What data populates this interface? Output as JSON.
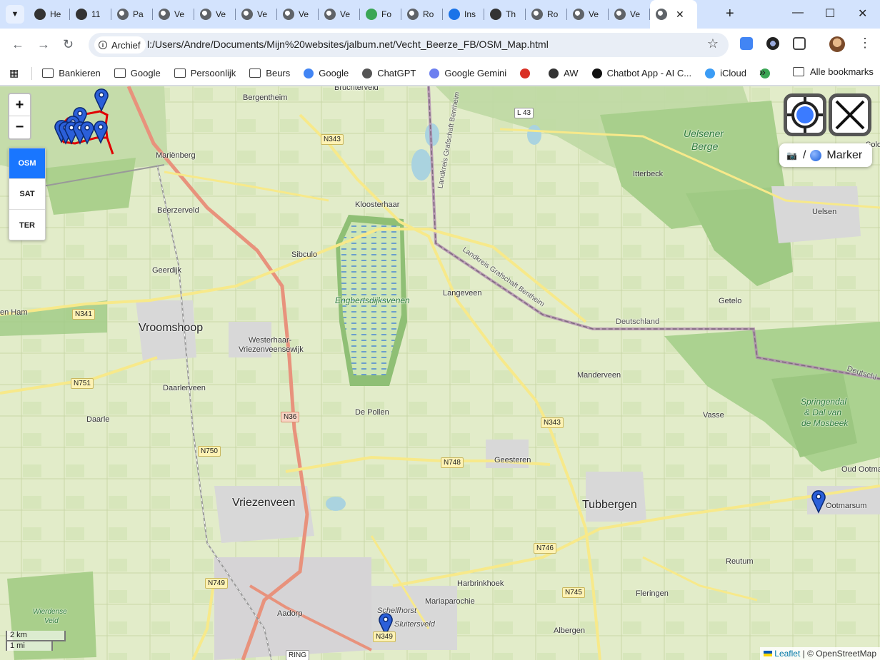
{
  "browser": {
    "tabs": [
      {
        "label": "He",
        "icon": "leaf-icon"
      },
      {
        "label": "11",
        "icon": "leaf-icon"
      },
      {
        "label": "Pa",
        "icon": "globe-icon"
      },
      {
        "label": "Ve",
        "icon": "globe-icon"
      },
      {
        "label": "Ve",
        "icon": "globe-icon"
      },
      {
        "label": "Ve",
        "icon": "globe-icon"
      },
      {
        "label": "Ve",
        "icon": "globe-icon"
      },
      {
        "label": "Ve",
        "icon": "globe-icon"
      },
      {
        "label": "Fo",
        "icon": "frog-icon"
      },
      {
        "label": "Ro",
        "icon": "globe-icon"
      },
      {
        "label": "Ins",
        "icon": "gear-icon"
      },
      {
        "label": "Th",
        "icon": "figure-icon"
      },
      {
        "label": "Ro",
        "icon": "globe-icon"
      },
      {
        "label": "Ve",
        "icon": "globe-icon"
      },
      {
        "label": "Ve",
        "icon": "globe-icon"
      }
    ],
    "active_tab_icon": "globe-icon",
    "close_label": "✕",
    "new_tab_label": "+",
    "minimize_label": "—",
    "maximize_label": "☐",
    "close_window_label": "✕",
    "address": {
      "chip_label": "Archief",
      "url": "l:/Users/Andre/Documents/Mijn%20websites/jalbum.net/Vecht_Beerze_FB/OSM_Map.html"
    },
    "bookmarks": [
      {
        "label": "Bankieren",
        "icon": "folder-icon"
      },
      {
        "label": "Google",
        "icon": "folder-icon"
      },
      {
        "label": "Persoonlijk",
        "icon": "folder-icon"
      },
      {
        "label": "Beurs",
        "icon": "folder-icon"
      },
      {
        "label": "Google",
        "icon": "google-icon"
      },
      {
        "label": "ChatGPT",
        "icon": "chatgpt-icon"
      },
      {
        "label": "Google Gemini",
        "icon": "gemini-icon"
      },
      {
        "label": "",
        "icon": "gmail-icon"
      },
      {
        "label": "AW",
        "icon": "leaf-icon"
      },
      {
        "label": "Chatbot App - AI C...",
        "icon": "chatbot-icon"
      },
      {
        "label": "iCloud",
        "icon": "cloud-icon"
      },
      {
        "label": "",
        "icon": "frog-icon"
      }
    ],
    "bookmarks_more": "»",
    "all_bookmarks": "Alle bookmarks"
  },
  "map": {
    "zoom_in": "+",
    "zoom_out": "−",
    "layers": [
      "OSM",
      "SAT",
      "TER"
    ],
    "selected_layer": "OSM",
    "legend": {
      "camera": "📷",
      "separator": "/",
      "label": "Marker"
    },
    "scale": {
      "metric": "2 km",
      "imperial": "1 mi"
    },
    "attribution": {
      "leaflet": "Leaflet",
      "rest": " | © OpenStreetMap"
    },
    "labels": {
      "bruchterveld": "Bruchterveld",
      "bergentheim": "Bergentheim",
      "mariënberg": "Mariënberg",
      "beerzerveld": "Beerzerveld",
      "kloosterhaar": "Kloosterhaar",
      "sibculo": "Sibculo",
      "geerdijk": "Geerdijk",
      "langeveen": "Langeveen",
      "engbertsdijksvenen": "Engbertsdijksvenen",
      "vroomshoop": "Vroomshoop",
      "enham": "en Ham",
      "westerhaar": "Westerhaar-",
      "vriezenveensewijk": "Vriezenveensewijk",
      "daarlerveen": "Daarlerveen",
      "daarle": "Daarle",
      "depollen": "De Pollen",
      "manderveen": "Manderveen",
      "geesteren": "Geesteren",
      "vriezenveen": "Vriezenveen",
      "tubbergen": "Tubbergen",
      "harbrinkhoek": "Harbrinkhoek",
      "mariaparochie": "Mariaparochie",
      "schelfhorst": "Schelfhorst",
      "sluitersveld": "Sluitersveld",
      "aadorp": "Aadorp",
      "albergen": "Albergen",
      "fleringen": "Fleringen",
      "reutum": "Reutum",
      "ootmarsum": "Ootmarsum",
      "oudootma": "Oud Ootma",
      "vasse": "Vasse",
      "getelo": "Getelo",
      "itterbeck": "Itterbeck",
      "uelsen": "Uelsen",
      "uelsener": "Uelsener",
      "berge": "Berge",
      "springendal1": "Springendal",
      "springendal2": "& Dal van",
      "springendal3": "de Mosbeek",
      "wierdense1": "Wierdense",
      "wierdense2": "Veld",
      "deutschland": "Deutschland",
      "deutschl2": "Deutschl",
      "landkreis1": "Landkreis Grafschaft Bentheim",
      "landkreis2": "Landkreis Grafschaft Bentheim",
      "solo": "Solo"
    },
    "roads": {
      "l43": "L 43",
      "n343a": "N343",
      "n341": "N341",
      "n751": "N751",
      "n36": "N36",
      "n750": "N750",
      "n343b": "N343",
      "n748": "N748",
      "n746": "N746",
      "n745": "N745",
      "n749": "N749",
      "n349": "N349",
      "ring": "RING"
    }
  }
}
